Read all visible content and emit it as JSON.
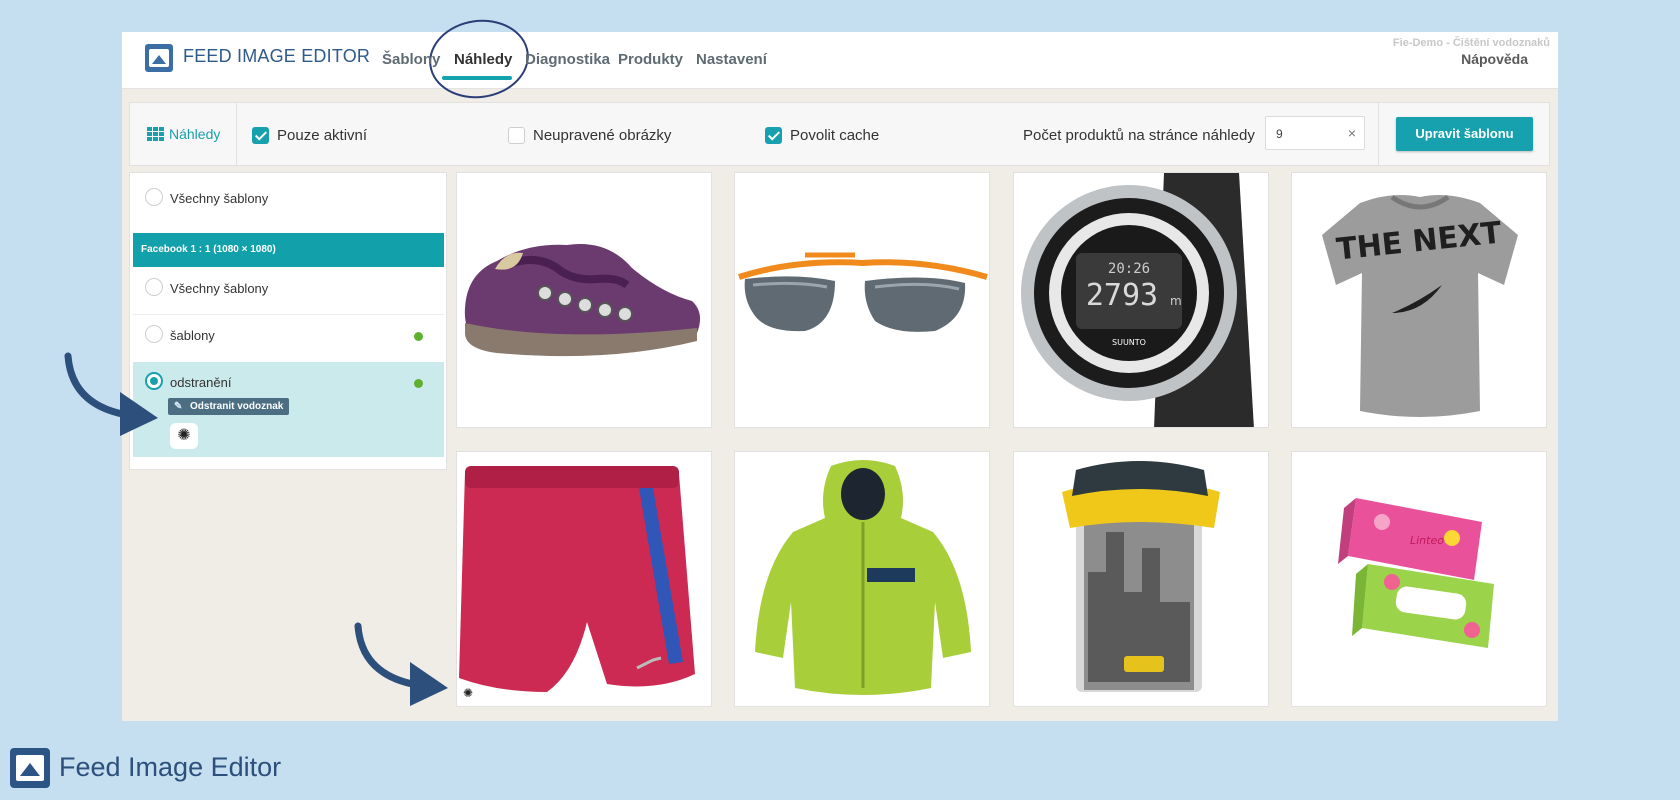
{
  "app": {
    "brand": "FEED IMAGE EDITOR",
    "nav": [
      "Šablony",
      "Náhledy",
      "Diagnostika",
      "Produkty",
      "Nastavení"
    ],
    "active_nav": "Náhledy",
    "demo_label": "Fie-Demo - Čištění vodoznaků",
    "help": "Nápověda",
    "accent_color": "#17a0ae"
  },
  "toolbar": {
    "previews_label": "Náhledy",
    "only_active": "Pouze aktivní",
    "only_active_checked": true,
    "unedited_images": "Neupravené obrázky",
    "unedited_images_checked": false,
    "allow_cache": "Povolit cache",
    "allow_cache_checked": true,
    "count_label": "Počet produktů na stránce náhledy",
    "count_value": "9",
    "clear_icon": "×",
    "edit_button": "Upravit šablonu"
  },
  "panel": {
    "all_templates_top": "Všechny šablony",
    "section_title": "Facebook 1 : 1 (1080 × 1080)",
    "items": [
      {
        "label": "Všechny šablony",
        "selected": false,
        "active_dot": false
      },
      {
        "label": "šablony",
        "selected": false,
        "active_dot": true
      },
      {
        "label": "odstranění",
        "selected": true,
        "active_dot": true
      }
    ],
    "tag_label": "Odstranit vodoznak",
    "tag_icon": "eraser-icon"
  },
  "products": [
    {
      "name": "shoe-image"
    },
    {
      "name": "sunglasses-image"
    },
    {
      "name": "watch-image",
      "watch_text": [
        "20:26",
        "2793",
        "m",
        "SUUNTO"
      ]
    },
    {
      "name": "tshirt-image",
      "shirt_text": "THE NEXT"
    },
    {
      "name": "shorts-image"
    },
    {
      "name": "jacket-image"
    },
    {
      "name": "trash-bin-image"
    },
    {
      "name": "tissue-box-image",
      "brand_text": "Linteo"
    }
  ],
  "footer": {
    "title": "Feed Image Editor"
  }
}
